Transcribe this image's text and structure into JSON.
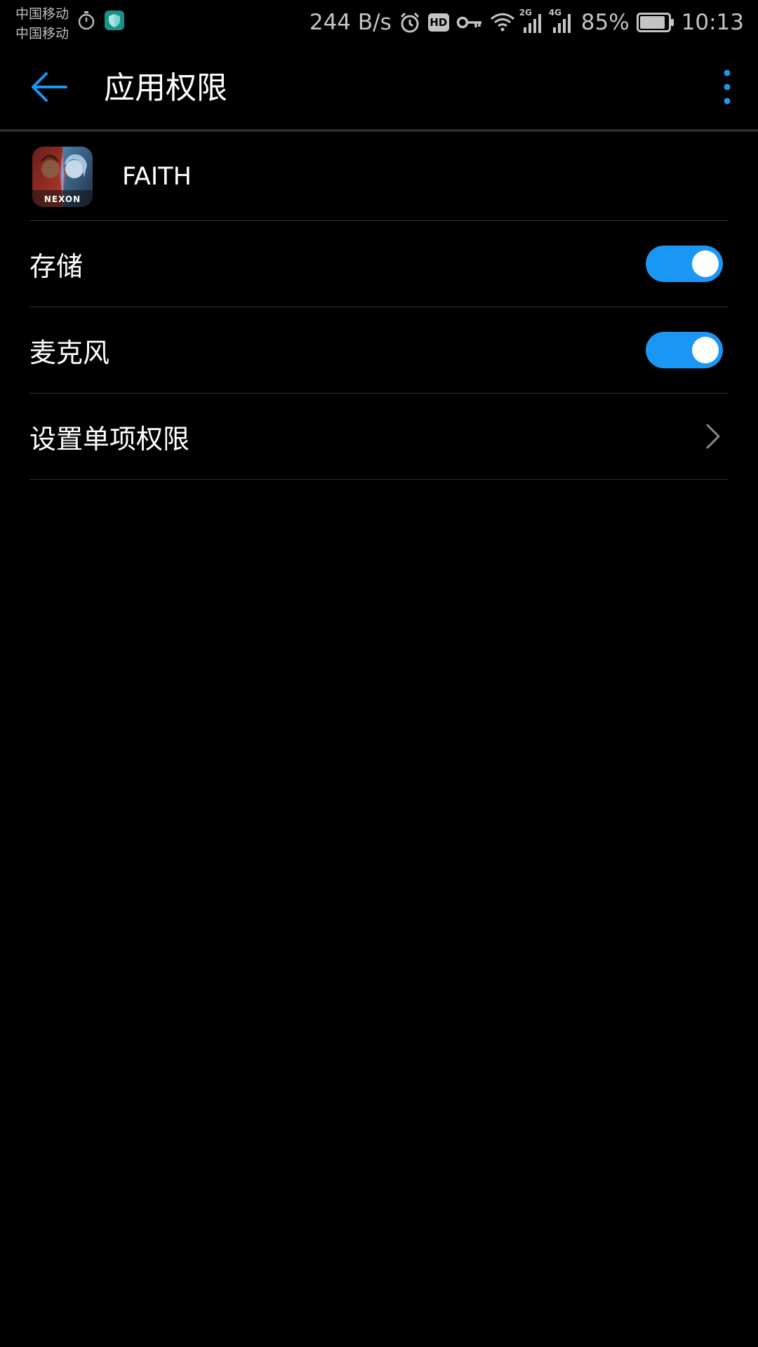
{
  "status_bar": {
    "carrier_1": "中国移动",
    "carrier_2": "中国移动",
    "net_speed": "244 B/s",
    "hd_label": "HD",
    "signal_1_type": "2G",
    "signal_2_type": "4G",
    "battery_percent": "85%",
    "time": "10:13",
    "left_icons": [
      "stopwatch-icon",
      "shield-app-icon"
    ],
    "right_icons": [
      "alarm-icon",
      "hd-icon",
      "vpn-key-icon",
      "wifi-icon",
      "signal-2g-icon",
      "signal-4g-icon",
      "battery-icon"
    ]
  },
  "app_bar": {
    "title": "应用权限",
    "back_icon": "arrow-left-icon",
    "menu_icon": "more-vertical-icon"
  },
  "app": {
    "name": "FAITH",
    "icon_label": "NEXON"
  },
  "permissions": [
    {
      "label": "存储",
      "enabled": true
    },
    {
      "label": "麦克风",
      "enabled": true
    }
  ],
  "individual_settings": {
    "label": "设置单项权限",
    "icon": "chevron-right-icon"
  },
  "colors": {
    "accent": "#1a97f5",
    "background": "#000000",
    "divider": "#333333",
    "status_text": "#c4c4c4"
  }
}
